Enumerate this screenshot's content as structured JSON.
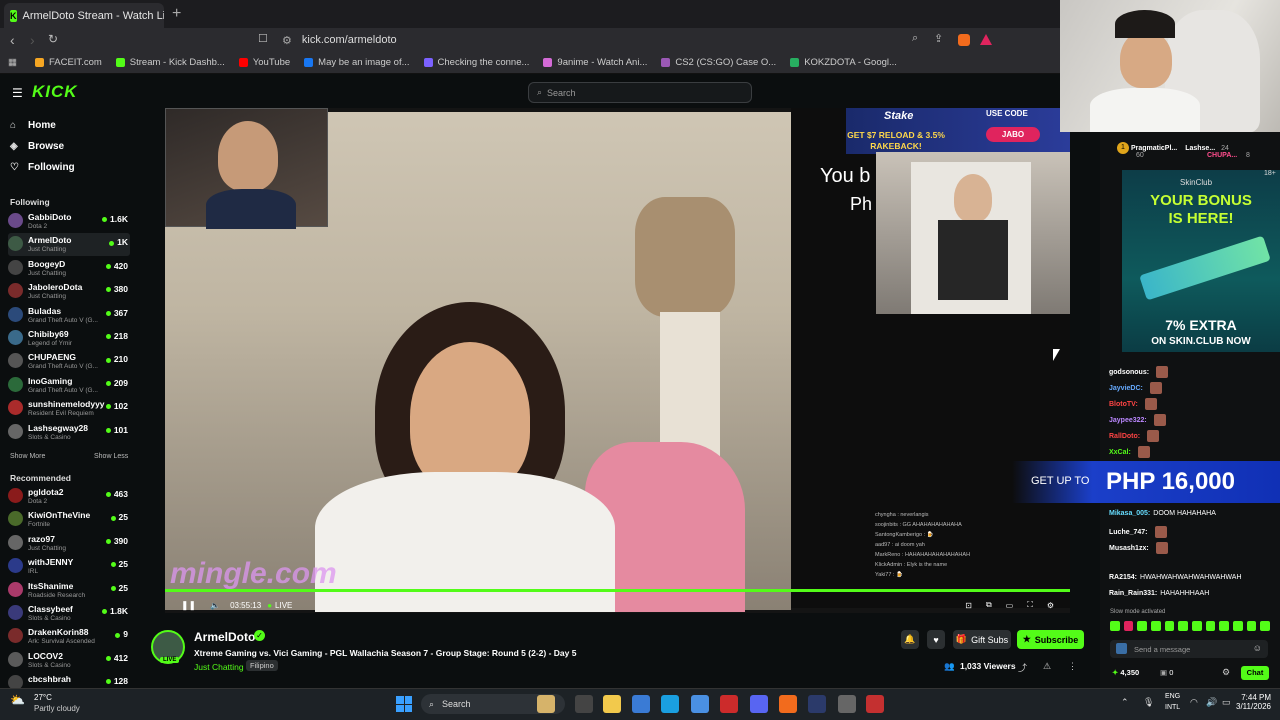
{
  "browser": {
    "tab_title": "ArmelDoto Stream - Watch Li",
    "tab_close": "✕",
    "new_tab": "+",
    "url": "kick.com/armeldoto",
    "bookmarks": [
      {
        "label": "FACEIT.com",
        "color": "#f5a623"
      },
      {
        "label": "Stream - Kick Dashb...",
        "color": "#53fc18"
      },
      {
        "label": "YouTube",
        "color": "#ff0000"
      },
      {
        "label": "May be an image of...",
        "color": "#1877f2"
      },
      {
        "label": "Checking the conne...",
        "color": "#7b61ff"
      },
      {
        "label": "9anime - Watch Ani...",
        "color": "#d36ad6"
      },
      {
        "label": "CS2 (CS:GO) Case O...",
        "color": "#9b59b6"
      },
      {
        "label": "KOKZDOTA - Googl...",
        "color": "#27ae60"
      }
    ]
  },
  "kick": {
    "logo": "KICK",
    "search_placeholder": "Search",
    "nav": [
      {
        "label": "Home",
        "icon": "⌂"
      },
      {
        "label": "Browse",
        "icon": "◈"
      },
      {
        "label": "Following",
        "icon": "♡"
      }
    ],
    "following_header": "Following",
    "following": [
      {
        "name": "GabbiDoto",
        "game": "Dota 2",
        "viewers": "1.6K",
        "color": "#6a4a8a"
      },
      {
        "name": "ArmelDoto",
        "game": "Just Chatting",
        "viewers": "1K",
        "color": "#3d5a45"
      },
      {
        "name": "BoogeyD",
        "game": "Just Chatting",
        "viewers": "420",
        "color": "#444"
      },
      {
        "name": "JaboleroDota",
        "game": "Just Chatting",
        "viewers": "380",
        "color": "#7a2b2b"
      },
      {
        "name": "Buladas",
        "game": "Grand Theft Auto V (G...",
        "viewers": "367",
        "color": "#2b4a7a"
      },
      {
        "name": "Chibiby69",
        "game": "Legend of Ymir",
        "viewers": "218",
        "color": "#3a6a8a"
      },
      {
        "name": "CHUPAENG",
        "game": "Grand Theft Auto V (G...",
        "viewers": "210",
        "color": "#555"
      },
      {
        "name": "InoGaming",
        "game": "Grand Theft Auto V (G...",
        "viewers": "209",
        "color": "#2b6a3a"
      },
      {
        "name": "sunshinemelodyyy",
        "game": "Resident Evil Requiem",
        "viewers": "102",
        "color": "#aa2b2b"
      },
      {
        "name": "Lashsegway28",
        "game": "Slots & Casino",
        "viewers": "101",
        "color": "#666"
      }
    ],
    "show_more": "Show More",
    "show_less": "Show Less",
    "recommended_header": "Recommended",
    "recommended": [
      {
        "name": "pgldota2",
        "game": "Dota 2",
        "viewers": "463",
        "color": "#8a1b1b"
      },
      {
        "name": "KiwiOnTheVine",
        "game": "Fortnite",
        "viewers": "25",
        "color": "#4a6a2a"
      },
      {
        "name": "razo97",
        "game": "Just Chatting",
        "viewers": "390",
        "color": "#666"
      },
      {
        "name": "withJENNY",
        "game": "IRL",
        "viewers": "25",
        "color": "#2b3a8a"
      },
      {
        "name": "ItsShanime",
        "game": "Roadside Research",
        "viewers": "25",
        "color": "#aa3a6a"
      },
      {
        "name": "Classybeef",
        "game": "Slots & Casino",
        "viewers": "1.8K",
        "color": "#3a3a7a"
      },
      {
        "name": "DrakenKorin88",
        "game": "Ark: Survival Ascended",
        "viewers": "9",
        "color": "#7a2b2b"
      },
      {
        "name": "LOCOV2",
        "game": "Slots & Casino",
        "viewers": "412",
        "color": "#5a5a5a"
      },
      {
        "name": "cbcshbrah",
        "game": "",
        "viewers": "128",
        "color": "#444"
      }
    ]
  },
  "player": {
    "stake_text": "GET $7 RELOAD & 3.5% RAKEBACK!",
    "stake_brand": "Stake",
    "use_code": "USE CODE",
    "code": "JABO",
    "overlay_text": "You b",
    "overlay_text2": "Ph",
    "watermark": "mingle.com",
    "time": "03:55:13",
    "live": "LIVE",
    "minichat": [
      "chyngha : neverlangis",
      "soojinbits : GG AHAHAHAHAHAHA",
      "SantongKamberigo : 🍺",
      "aad97 : ai doom yah",
      "MarkReno : HAHAHAHAHAHAHAHAH",
      "KlickAdmin : Elyk is the name",
      "Yaki77 : 🍺"
    ]
  },
  "stream": {
    "name": "ArmelDoto",
    "live_badge": "LIVE",
    "title": "Xtreme Gaming vs. Vici Gaming - PGL Wallachia Season 7 - Group Stage: Round 5 (2-2) - Day 5",
    "category": "Just Chatting",
    "language": "Filipino",
    "gift_subs": "Gift Subs",
    "subscribe": "Subscribe",
    "viewers": "1,033 Viewers"
  },
  "chat": {
    "top_user1": "PragmaticPl...",
    "top_user1_val": "60",
    "top_user2": "Lashse...",
    "top_user2_val": "24",
    "top_user3": "CHUPA...",
    "top_user3_val": "8",
    "ad_brand": "SkinClub",
    "ad_age": "18+",
    "ad_headline1": "YOUR BONUS",
    "ad_headline2": "IS HERE!",
    "ad_extra": "7% EXTRA",
    "ad_cta": "ON SKIN.CLUB NOW",
    "php_prefix": "GET UP TO",
    "php_amount": "PHP 16,000",
    "messages": [
      {
        "user": "godsonous:",
        "text": "",
        "color": "#ffffff"
      },
      {
        "user": "JayvieDC:",
        "text": "",
        "color": "#66aaff"
      },
      {
        "user": "BlotoTV:",
        "text": "",
        "color": "#ff4444"
      },
      {
        "user": "Jaypee322:",
        "text": "",
        "color": "#bb88ff"
      },
      {
        "user": "RallDoto:",
        "text": "",
        "color": "#ff4444"
      },
      {
        "user": "XxCal:",
        "text": "",
        "color": "#53fc18"
      },
      {
        "user": "Mikasa_005:",
        "text": "DOOM HAHAHAHA",
        "color": "#66ddff"
      },
      {
        "user": "Luche_747:",
        "text": "",
        "color": "#ffffff"
      },
      {
        "user": "Musash1zx:",
        "text": "",
        "color": "#ffffff"
      },
      {
        "user": "RA2154:",
        "text": "HWAHWAHWAHWAHWAHWAH",
        "color": "#ffffff"
      },
      {
        "user": "Rain_Rain331:",
        "text": "HAHAHHHAAH",
        "color": "#ffffff"
      }
    ],
    "slow_mode": "Slow mode activated",
    "input_placeholder": "Send a message",
    "points": "4,350",
    "count": "0",
    "chat_button": "Chat"
  },
  "taskbar": {
    "temp": "27°C",
    "weather": "Partly cloudy",
    "search": "Search",
    "lang1": "ENG",
    "lang2": "INTL",
    "time": "7:44 PM",
    "date": "3/11/2026"
  }
}
